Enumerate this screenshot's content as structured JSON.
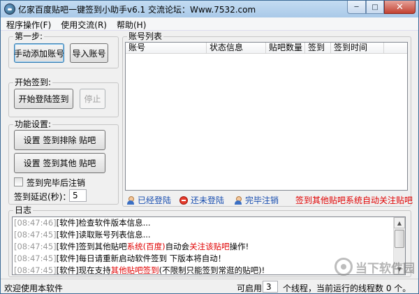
{
  "window": {
    "title": "亿家百度贴吧一键签到小助手v6.1   交流论坛：Www.7532.com",
    "min_glyph": "─",
    "max_glyph": "□",
    "close_glyph": "✕"
  },
  "menu": [
    {
      "label": "程序操作(F)"
    },
    {
      "label": "使用交流(R)"
    },
    {
      "label": "帮助(H)"
    }
  ],
  "step1": {
    "label": "第一步:",
    "manual_add": "手动添加账号",
    "import": "导入账号"
  },
  "start_signin": {
    "label": "开始签到:",
    "start": "开始登陆签到",
    "stop": "停止"
  },
  "features": {
    "label": "功能设置:",
    "exclude": "设置 签到排除 贴吧",
    "other": "设置 签到其他 贴吧",
    "logout_after_checkbox": "签到完毕后注销",
    "delay_label": "签到延迟(秒)：",
    "delay_value": "5"
  },
  "accounts": {
    "label": "账号列表",
    "columns": [
      "账号",
      "状态信息",
      "贴吧数量",
      "签到",
      "签到时间"
    ]
  },
  "legend": {
    "logged_in": "已经登陆",
    "not_logged": "还未登陆",
    "done": "完毕注销",
    "link": "签到其他贴吧系统自动关注贴吧"
  },
  "log": {
    "label": "日志",
    "lines": [
      {
        "ts": "[08:47:46]",
        "parts": [
          {
            "t": "[软件]检查软件版本信息..."
          }
        ]
      },
      {
        "ts": "[08:47:45]",
        "parts": [
          {
            "t": "[软件]读取账号列表信息..."
          }
        ]
      },
      {
        "ts": "[08:47:45]",
        "parts": [
          {
            "t": "[软件]签到其他贴吧"
          },
          {
            "t": "系统(百度)",
            "red": true
          },
          {
            "t": "自动会"
          },
          {
            "t": "关注该贴吧",
            "red": true
          },
          {
            "t": "操作!"
          }
        ]
      },
      {
        "ts": "[08:47:45]",
        "parts": [
          {
            "t": "[软件]每日请重新启动软件签到  下版本将自动！"
          }
        ]
      },
      {
        "ts": "[08:47:45]",
        "parts": [
          {
            "t": "[软件]现在支持"
          },
          {
            "t": "其他贴吧签到",
            "red": true
          },
          {
            "t": "(不限制只能签到常逛的贴吧)!"
          }
        ]
      }
    ]
  },
  "status": {
    "welcome": "欢迎使用本软件",
    "enable_label": "可启用",
    "threads_value": "3",
    "running_label": "个线程，当前运行的线程数 0 个。"
  },
  "colors": {
    "titlebar": "#b9d4ee",
    "red_text": "#e00000",
    "blue_text": "#1a4fb0"
  },
  "watermark": {
    "text": "当下软件园"
  }
}
